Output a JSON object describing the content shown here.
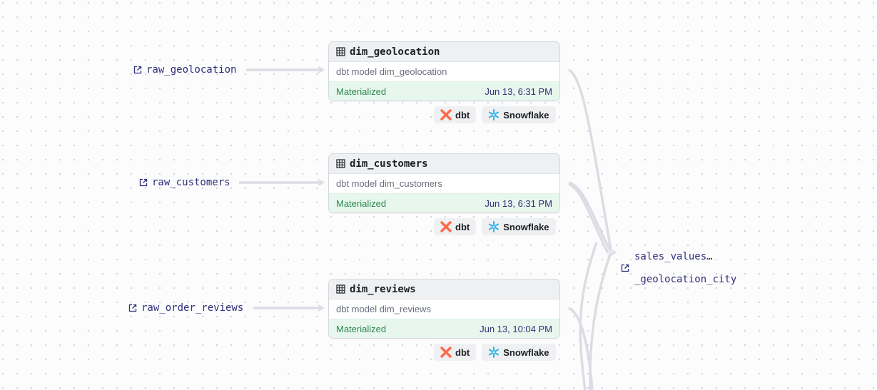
{
  "sources": [
    {
      "label": "raw_geolocation",
      "icon": "external-link-icon"
    },
    {
      "label": "raw_customers",
      "icon": "external-link-icon"
    },
    {
      "label": "raw_order_reviews",
      "icon": "external-link-icon"
    }
  ],
  "models": [
    {
      "title": "dim_geolocation",
      "description": "dbt model dim_geolocation",
      "status": "Materialized",
      "timestamp": "Jun 13, 6:31 PM",
      "icon": "table-icon"
    },
    {
      "title": "dim_customers",
      "description": "dbt model dim_customers",
      "status": "Materialized",
      "timestamp": "Jun 13, 6:31 PM",
      "icon": "table-icon"
    },
    {
      "title": "dim_reviews",
      "description": "dbt model dim_reviews",
      "status": "Materialized",
      "timestamp": "Jun 13, 10:04 PM",
      "icon": "table-icon"
    }
  ],
  "tags": {
    "dbt": "dbt",
    "snowflake": "Snowflake"
  },
  "target": {
    "line1": "sales_values…",
    "line2": "_geolocation_city",
    "icon": "external-link-icon"
  },
  "colors": {
    "status_green": "#2d8650",
    "link_navy": "#2f2f7a",
    "dbt_orange": "#ff694a",
    "snowflake_blue": "#29b5e8",
    "edge_gray": "#dcdde4"
  }
}
